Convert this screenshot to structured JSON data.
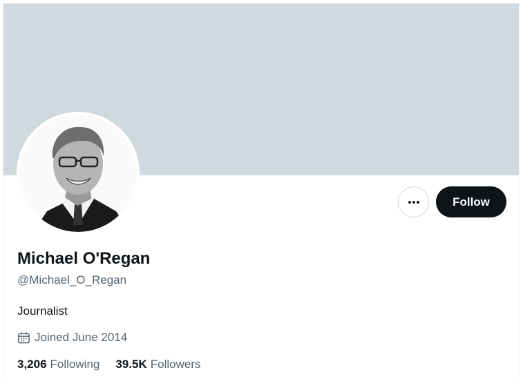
{
  "profile": {
    "display_name": "Michael O'Regan",
    "handle": "@Michael_O_Regan",
    "bio": "Journalist",
    "joined": "Joined June 2014",
    "joined_icon": "calendar-icon"
  },
  "actions": {
    "more_icon": "more-horizontal-icon",
    "follow_label": "Follow"
  },
  "stats": {
    "following_count": "3,206",
    "following_label": "Following",
    "followers_count": "39.5K",
    "followers_label": "Followers"
  },
  "colors": {
    "banner": "#cfd9de",
    "primary_text": "#0f1419",
    "secondary_text": "#536471",
    "follow_button": "#0f1419"
  }
}
